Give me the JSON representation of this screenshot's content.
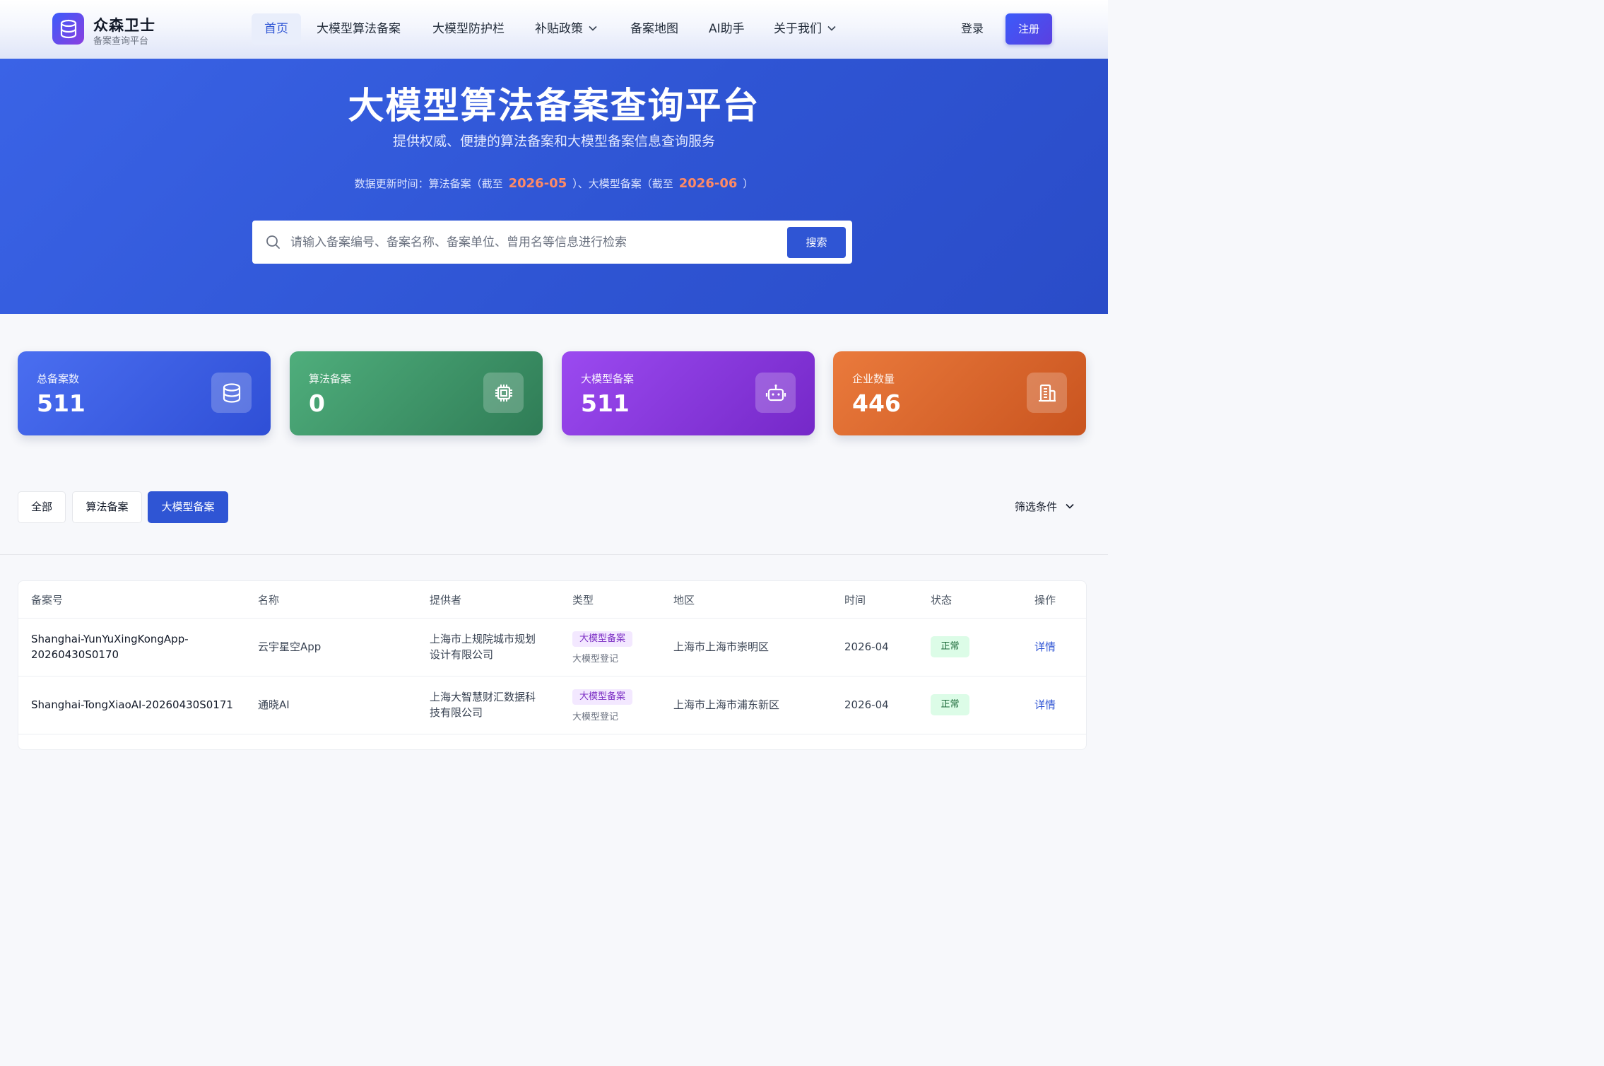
{
  "brand": {
    "name": "众森卫士",
    "subtitle": "备案查询平台"
  },
  "nav": {
    "items": [
      {
        "label": "首页",
        "active": true
      },
      {
        "label": "大模型算法备案"
      },
      {
        "label": "大模型防护栏"
      },
      {
        "label": "补贴政策",
        "dropdown": true
      },
      {
        "label": "备案地图"
      },
      {
        "label": "AI助手"
      },
      {
        "label": "关于我们",
        "dropdown": true
      }
    ],
    "login": "登录",
    "register": "注册"
  },
  "hero": {
    "title": "大模型算法备案查询平台",
    "subtitle": "提供权威、便捷的算法备案和大模型备案信息查询服务",
    "update_prefix": "数据更新时间：算法备案（截至",
    "algo_date": "2026-05",
    "update_mid": "）、大模型备案（截至",
    "model_date": "2026-06",
    "update_suffix": "）",
    "search_placeholder": "请输入备案编号、备案名称、备案单位、曾用名等信息进行检索",
    "search_button": "搜索"
  },
  "stats": [
    {
      "label": "总备案数",
      "value": "511",
      "icon": "database-icon",
      "color_from": "#4a6ef0",
      "color_to": "#2f4fd6"
    },
    {
      "label": "算法备案",
      "value": "0",
      "icon": "chip-icon",
      "color_from": "#4fae7c",
      "color_to": "#2f7c56"
    },
    {
      "label": "大模型备案",
      "value": "511",
      "icon": "robot-icon",
      "color_from": "#9b4af0",
      "color_to": "#7528c8"
    },
    {
      "label": "企业数量",
      "value": "446",
      "icon": "building-icon",
      "color_from": "#ea7a3c",
      "color_to": "#c9541f"
    }
  ],
  "tabs": [
    {
      "label": "全部"
    },
    {
      "label": "算法备案"
    },
    {
      "label": "大模型备案",
      "active": true
    }
  ],
  "filter_label": "筛选条件",
  "table": {
    "headers": [
      "备案号",
      "名称",
      "提供者",
      "类型",
      "地区",
      "时间",
      "状态",
      "操作"
    ],
    "rows": [
      {
        "id_line1": "Shanghai-YunYuXingKongApp-",
        "id_line2": "20260430S0170",
        "name": "云宇星空App",
        "provider_line1": "上海市上规院城市规划",
        "provider_line2": "设计有限公司",
        "type": "大模型备案",
        "type_sub": "大模型登记",
        "region": "上海市上海市崇明区",
        "time": "2026-04",
        "status": "正常",
        "action": "详情"
      },
      {
        "id_line1": "Shanghai-TongXiaoAI-20260430S0171",
        "id_line2": "",
        "name": "通晓AI",
        "provider_line1": "上海大智慧财汇数据科",
        "provider_line2": "技有限公司",
        "type": "大模型备案",
        "type_sub": "大模型登记",
        "region": "上海市上海市浦东新区",
        "time": "2026-04",
        "status": "正常",
        "action": "详情"
      }
    ]
  }
}
